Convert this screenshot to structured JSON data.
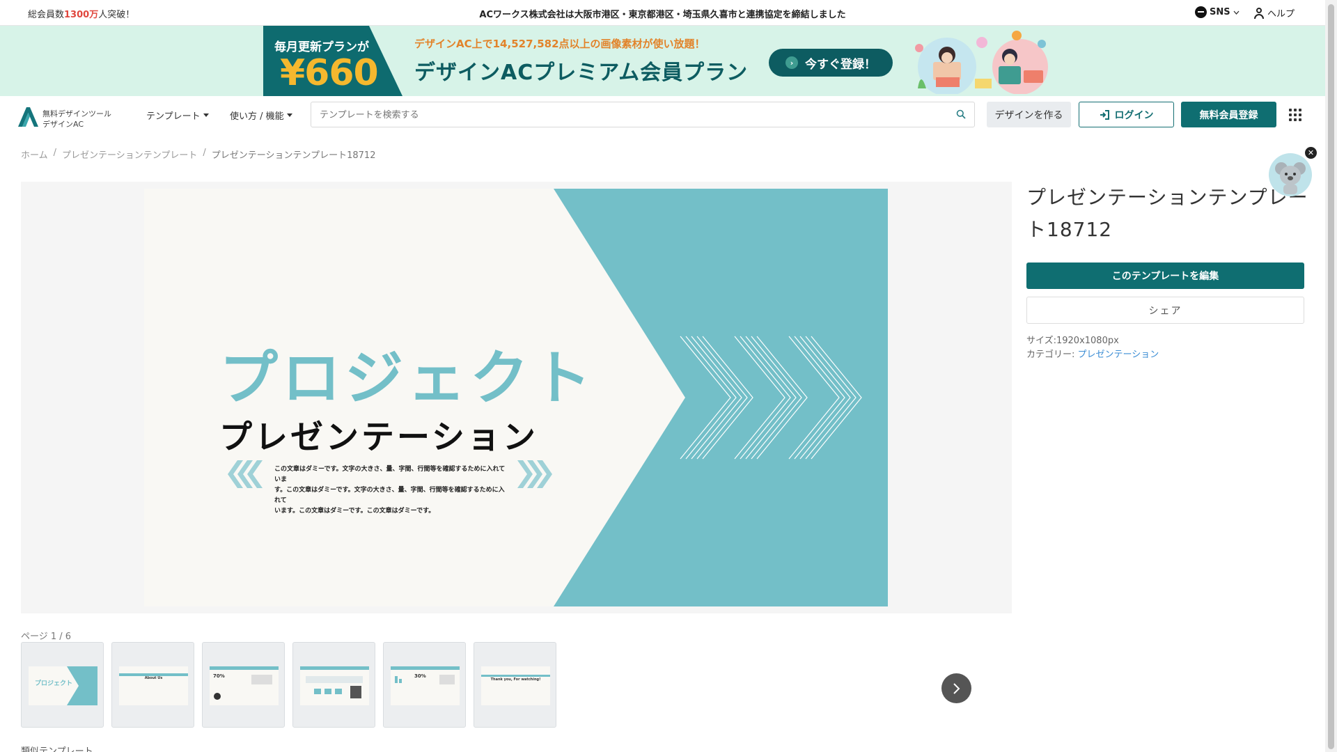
{
  "topbar": {
    "members_prefix": "総会員数",
    "members_count": "1300万",
    "members_suffix": "人突破！",
    "notice": "ACワークス株式会社は大阪市港区・東京都港区・埼玉県久喜市と連携協定を締結しました",
    "sns_label": "SNS",
    "help_label": "ヘルプ"
  },
  "banner": {
    "monthly_label": "毎月更新プランが",
    "price": "¥660",
    "promo": "デザインAC上で14,527,582点以上の画像素材が使い放題！",
    "plan_title": "デザインACプレミアム会員プラン",
    "cta": "今すぐ登録！"
  },
  "header": {
    "logo_line1": "無料デザインツール",
    "logo_line2": "デザインAC",
    "nav_templates": "テンプレート",
    "nav_howto": "使い方 / 機能",
    "search_placeholder": "テンプレートを検索する",
    "make_design": "デザインを作る",
    "login": "ログイン",
    "signup": "無料会員登録"
  },
  "breadcrumb": [
    "ホーム",
    "/",
    "プレゼンテーションテンプレート",
    "/",
    "プレゼンテーションテンプレート18712"
  ],
  "slide": {
    "title1": "プロジェクト",
    "title2": "プレゼンテーション",
    "body_line1": "この文章はダミーです。文字の大きさ、量、字間、行間等を確認するために入れていま",
    "body_line2": "す。この文章はダミーです。文字の大きさ、量、字間、行間等を確認するために入れて",
    "body_line3": "います。この文章はダミーです。この文章はダミーです。"
  },
  "panel": {
    "title": "プレゼンテーションテンプレート18712",
    "edit_button": "このテンプレートを編集",
    "share_button": "シェア",
    "size_label": "サイズ:1920x1080px",
    "category_label": "カテゴリー:",
    "category_value": "プレゼンテーション"
  },
  "pages": {
    "label": "ページ 1 / 6",
    "thumbs": [
      {
        "caption": "プロジェクト"
      },
      {
        "caption": "About Us"
      },
      {
        "caption": "70%"
      },
      {
        "caption": ""
      },
      {
        "caption": "30%"
      },
      {
        "caption": "Thank you, For watching!"
      }
    ]
  },
  "similar_label": "類似テンプレート",
  "colors": {
    "brand_teal": "#0f6e71",
    "slide_teal": "#73bfc8",
    "banner_bg": "#d7f3e8",
    "price_gold": "#f5b82e",
    "promo_orange": "#e2832a"
  }
}
